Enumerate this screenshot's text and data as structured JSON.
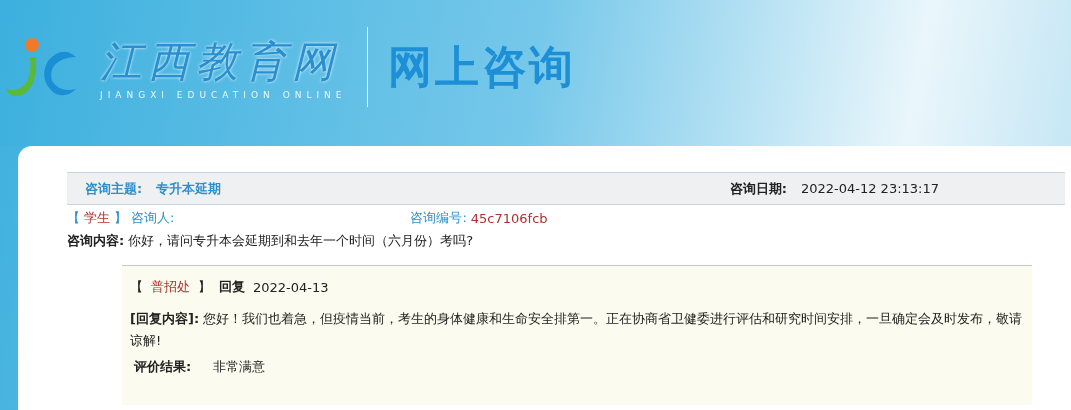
{
  "header": {
    "site_name": "江西教育网",
    "site_subtitle": "JIANGXI EDUCATION ONLINE",
    "page_title": "网上咨询"
  },
  "consultation": {
    "subject_label": "咨询主题:",
    "subject": "专升本延期",
    "date_label": "咨询日期:",
    "date": "2022-04-12 23:13:17",
    "role_open": "【",
    "asker_role": "学生",
    "role_close": "】",
    "asker_label": "咨询人:",
    "number_label": "咨询编号:",
    "number": "45c7106fcb",
    "content_label": "咨询内容:",
    "content": "你好，请问专升本会延期到和去年一个时间（六月份）考吗?"
  },
  "reply": {
    "office_open": "【",
    "office": "普招处",
    "office_close": "】",
    "reply_label": "回复",
    "reply_date": "2022-04-13",
    "content": "**[回复内容]:** 您好！我们也着急，但疫情当前，考生的身体健康和生命安全排第一。正在协商省卫健委进行评估和研究时间安排，一旦确定会及时发布，敬请谅解!",
    "rating_label": "评价结果:",
    "rating": "非常满意"
  }
}
